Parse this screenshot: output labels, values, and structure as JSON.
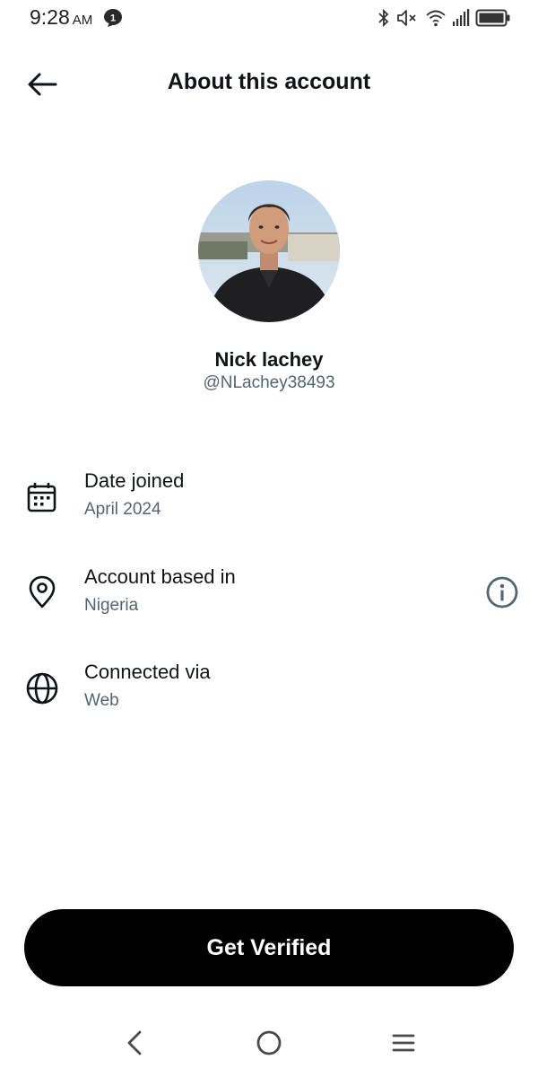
{
  "status_bar": {
    "time": "9:28",
    "ampm": "AM",
    "notification_count": "1",
    "icons": [
      "bluetooth-icon",
      "mute-icon",
      "wifi-icon",
      "signal-icon",
      "battery-icon"
    ]
  },
  "header": {
    "title": "About this account",
    "back_icon": "arrow-left-icon"
  },
  "profile": {
    "name": "Nick lachey",
    "handle": "@NLachey38493"
  },
  "info_rows": [
    {
      "icon": "calendar-icon",
      "label": "Date joined",
      "value": "April 2024"
    },
    {
      "icon": "location-pin-icon",
      "label": "Account based in",
      "value": "Nigeria",
      "trailing_icon": "info-icon"
    },
    {
      "icon": "globe-icon",
      "label": "Connected via",
      "value": "Web"
    }
  ],
  "cta": {
    "label": "Get Verified"
  },
  "nav_bar": [
    "back-nav-icon",
    "home-nav-icon",
    "menu-nav-icon"
  ],
  "colors": {
    "primary_text": "#0f1419",
    "secondary_text": "#536471",
    "button_bg": "#000000",
    "background": "#ffffff"
  }
}
